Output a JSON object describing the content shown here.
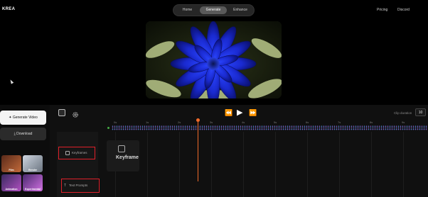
{
  "app": {
    "logo": "KREA"
  },
  "nav": {
    "tabs": [
      {
        "label": "Home"
      },
      {
        "label": "Generate",
        "active": true
      },
      {
        "label": "Enhance"
      }
    ],
    "links": [
      {
        "label": "Pricing"
      },
      {
        "label": "Discord"
      }
    ]
  },
  "sidebar": {
    "generate_label": "Generate Video",
    "download_label": "Download",
    "styles": [
      {
        "label": "Film"
      },
      {
        "label": "Render"
      },
      {
        "label": "Animation"
      },
      {
        "label": "Experimental"
      }
    ]
  },
  "timeline": {
    "clip_duration_label": "Clip duration",
    "clip_duration_value": "10",
    "ticks": [
      "0s",
      "1s",
      "2s",
      "3s",
      "4s",
      "5s",
      "6s",
      "7s",
      "8s",
      "9s"
    ],
    "lanes": {
      "keyframes_label": "Keyframes",
      "prompts_label": "Text Prompts"
    },
    "keyframe_tile_label": "Keyframe",
    "playhead_time": 2.6
  },
  "colors": {
    "accent": "#ef6a2a",
    "highlight": "#e0202a",
    "active_tab": "#5a5a5a"
  }
}
